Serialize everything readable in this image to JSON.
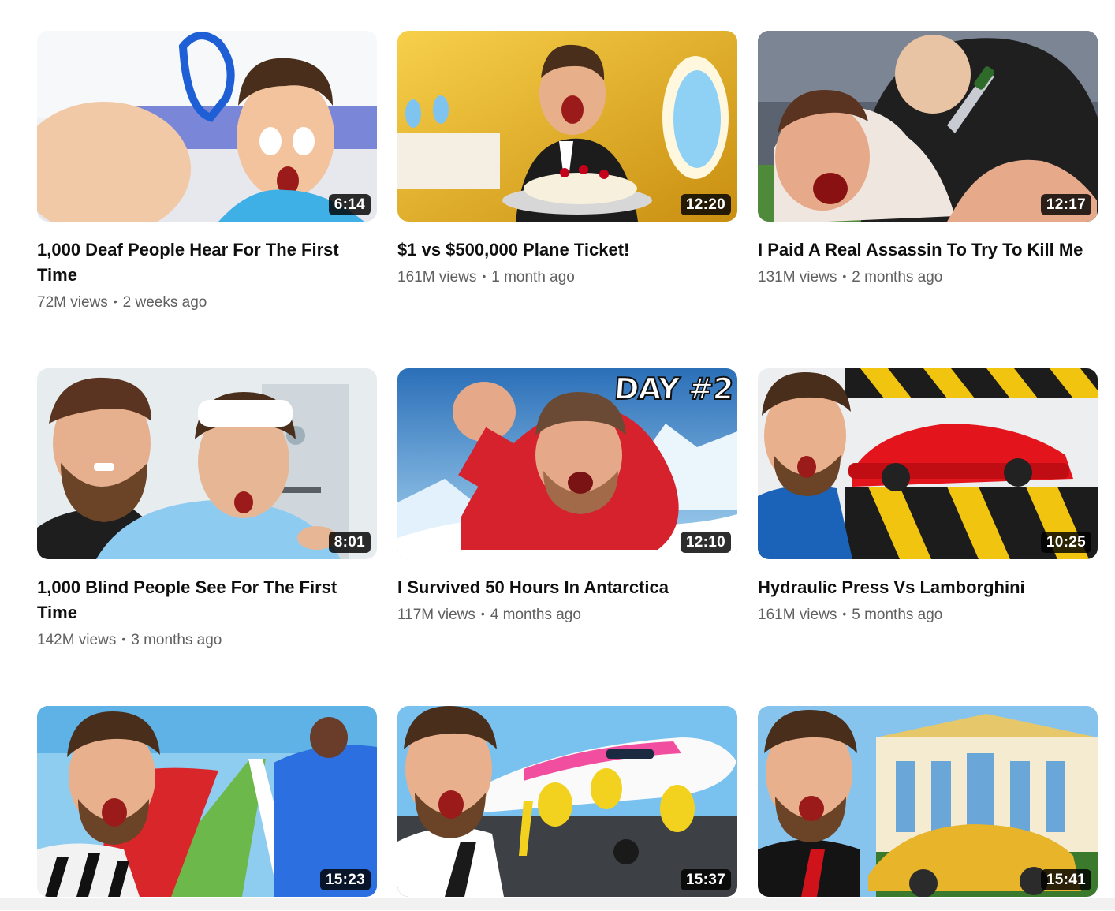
{
  "videos": [
    {
      "title": "1,000 Deaf People Hear For The First Time",
      "views": "72M views",
      "age": "2 weeks ago",
      "duration": "6:14",
      "thumb": "hospital-boy-earpiece"
    },
    {
      "title": "$1 vs $500,000 Plane Ticket!",
      "views": "161M views",
      "age": "1 month ago",
      "duration": "12:20",
      "thumb": "gold-jet-interior"
    },
    {
      "title": "I Paid A Real Assassin To Try To Kill Me",
      "views": "131M views",
      "age": "2 months ago",
      "duration": "12:17",
      "thumb": "assassin-attack"
    },
    {
      "title": "1,000 Blind People See For The First Time",
      "views": "142M views",
      "age": "3 months ago",
      "duration": "8:01",
      "thumb": "hospital-bandage-boy"
    },
    {
      "title": "I Survived 50 Hours In Antarctica",
      "views": "117M views",
      "age": "4 months ago",
      "duration": "12:10",
      "thumb": "antarctica-snow",
      "badge": "DAY #2"
    },
    {
      "title": "Hydraulic Press Vs Lamborghini",
      "views": "161M views",
      "age": "5 months ago",
      "duration": "10:25",
      "thumb": "press-red-car"
    },
    {
      "title": "",
      "views": "",
      "age": "",
      "duration": "15:23",
      "thumb": "tug-of-war-field"
    },
    {
      "title": "",
      "views": "",
      "age": "",
      "duration": "15:37",
      "thumb": "private-jet-runway"
    },
    {
      "title": "",
      "views": "",
      "age": "",
      "duration": "15:41",
      "thumb": "mansion-gold-car"
    }
  ],
  "separator": "•"
}
